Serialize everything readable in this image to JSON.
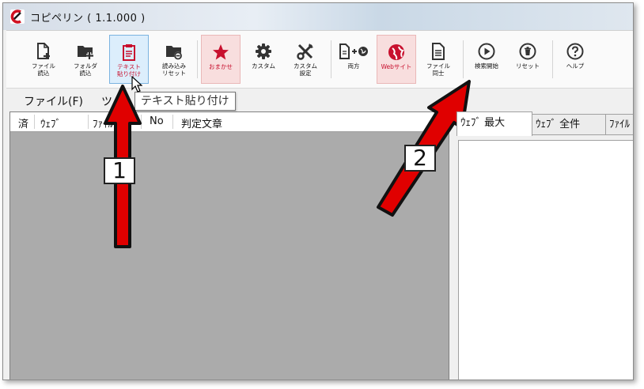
{
  "window": {
    "title": "コピペリン ( 1.1.000 )"
  },
  "toolbar": {
    "file_load": "ファイル\n読込",
    "folder_load": "フォルダ\n読込",
    "text_paste": "テキスト\n貼り付け",
    "load_reset": "読み込み\nリセット",
    "omakase": "おまかせ",
    "custom": "カスタム",
    "custom_settings": "カスタム\n設定",
    "both": "両方",
    "website": "Webサイト",
    "file_compare": "ファイル\n同士",
    "start_search": "検索開始",
    "reset": "リセット",
    "help": "ヘルプ"
  },
  "menu": {
    "file": "ファイル(F)",
    "tools_partial": "ツ"
  },
  "tooltip": "テキスト貼り付け",
  "list": {
    "columns": [
      "済",
      "ｳｪﾌﾞ",
      "ﾌｧｲﾙ",
      "No",
      "判定文章"
    ]
  },
  "tabs": [
    "ｳｪﾌﾞ 最大",
    "ｳｪﾌﾞ 全件",
    "ﾌｧｲﾙ"
  ],
  "annotations": {
    "callout_1": "1",
    "callout_2": "2"
  },
  "colors": {
    "accent_red": "#c8102e",
    "arrow_red": "#e00000",
    "panel_gray": "#ababab"
  }
}
